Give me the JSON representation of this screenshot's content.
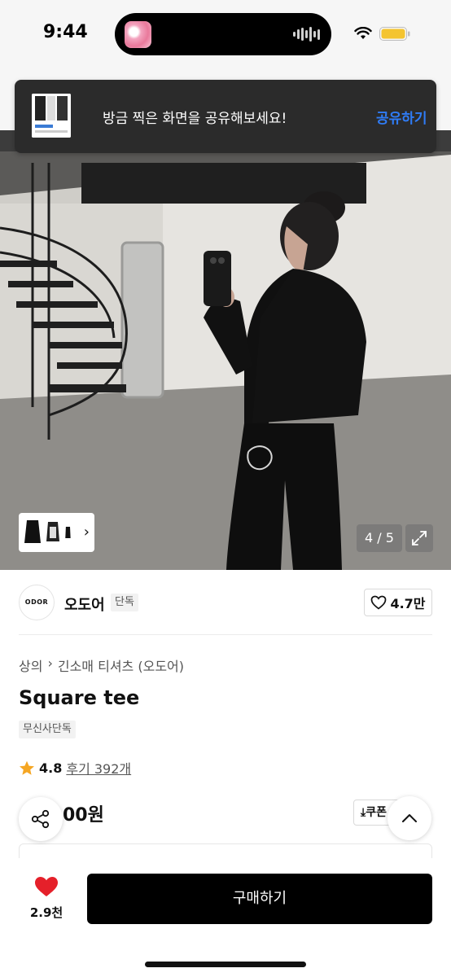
{
  "status_bar": {
    "time": "9:44",
    "battery_color": "#f4c430"
  },
  "toast": {
    "message": "방금 찍은 화면을 공유해보세요!",
    "action": "공유하기",
    "action_color": "#2f7cf6"
  },
  "gallery": {
    "counter": "4 / 5"
  },
  "brand": {
    "logo_text": "ODOR",
    "name": "오도어",
    "badge": "단독",
    "likes": "4.7만"
  },
  "product": {
    "breadcrumb": [
      "상의",
      "긴소매 티셔츠 (오도어)"
    ],
    "title": "Square tee",
    "tag": "무신사단독",
    "rating": "4.8",
    "reviews": "후기 392개",
    "price": "00원",
    "coupon_label": "쿠폰"
  },
  "bottom_bar": {
    "wish_count": "2.9천",
    "buy_label": "구매하기",
    "wish_color": "#e5202a"
  }
}
